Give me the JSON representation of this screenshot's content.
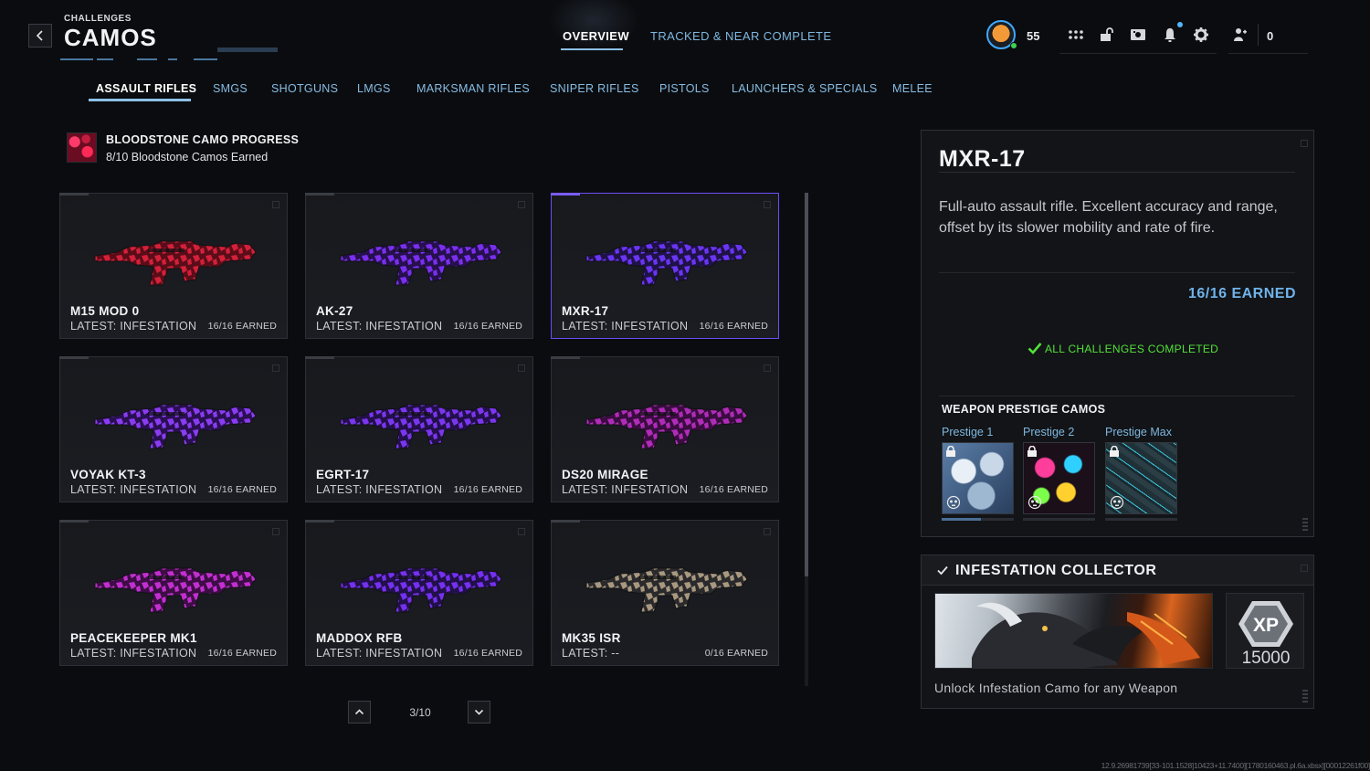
{
  "header": {
    "super_title": "CHALLENGES",
    "title": "CAMOS",
    "tabs": [
      {
        "label": "OVERVIEW",
        "active": true
      },
      {
        "label": "TRACKED & NEAR COMPLETE",
        "active": false
      }
    ],
    "level": "55",
    "currency": "0",
    "icons": [
      "grid-icon",
      "lock-icon",
      "store-icon",
      "bell-icon",
      "gear-icon",
      "party-icon"
    ]
  },
  "categories": [
    {
      "label": "ASSAULT RIFLES",
      "active": true
    },
    {
      "label": "SMGS"
    },
    {
      "label": "SHOTGUNS"
    },
    {
      "label": "LMGS"
    },
    {
      "label": "MARKSMAN RIFLES"
    },
    {
      "label": "SNIPER RIFLES"
    },
    {
      "label": "PISTOLS"
    },
    {
      "label": "LAUNCHERS & SPECIALS"
    },
    {
      "label": "MELEE"
    }
  ],
  "progress": {
    "title": "BLOODSTONE CAMO PROGRESS",
    "subtitle": "8/10 Bloodstone Camos Earned"
  },
  "weapons": [
    {
      "name": "M15 MOD 0",
      "latest": "LATEST: INFESTATION",
      "earned": "16/16 EARNED",
      "camo": "#d4203a",
      "accent": "#5a0d18"
    },
    {
      "name": "AK-27",
      "latest": "LATEST: INFESTATION",
      "earned": "16/16 EARNED",
      "camo": "#7a2ff0",
      "accent": "#26104d"
    },
    {
      "name": "MXR-17",
      "latest": "LATEST: INFESTATION",
      "earned": "16/16 EARNED",
      "camo": "#6a35f5",
      "accent": "#1f1247",
      "selected": true
    },
    {
      "name": "VOYAK KT-3",
      "latest": "LATEST: INFESTATION",
      "earned": "16/16 EARNED",
      "camo": "#8a3cf2",
      "accent": "#2a1052"
    },
    {
      "name": "EGRT-17",
      "latest": "LATEST: INFESTATION",
      "earned": "16/16 EARNED",
      "camo": "#7b36ef",
      "accent": "#23104a"
    },
    {
      "name": "DS20 MIRAGE",
      "latest": "LATEST: INFESTATION",
      "earned": "16/16 EARNED",
      "camo": "#b02cb8",
      "accent": "#3a0d40"
    },
    {
      "name": "PEACEKEEPER MK1",
      "latest": "LATEST: INFESTATION",
      "earned": "16/16 EARNED",
      "camo": "#c22fd0",
      "accent": "#3d0e45"
    },
    {
      "name": "MADDOX RFB",
      "latest": "LATEST: INFESTATION",
      "earned": "16/16 EARNED",
      "camo": "#7530f0",
      "accent": "#22104a"
    },
    {
      "name": "MK35 ISR",
      "latest": "LATEST: --",
      "earned": "0/16 EARNED",
      "camo": "#a89880",
      "accent": "#2a2a2c"
    }
  ],
  "pager": {
    "label": "3/10"
  },
  "detail": {
    "name": "MXR-17",
    "description": "Full-auto assault rifle. Excellent accuracy and range, offset by its slower mobility and rate of fire.",
    "earned": "16/16 EARNED",
    "status": "ALL CHALLENGES COMPLETED",
    "prestige_title": "WEAPON PRESTIGE CAMOS",
    "prestige": [
      {
        "label": "Prestige 1",
        "progress": 0.55
      },
      {
        "label": "Prestige 2",
        "progress": 0
      },
      {
        "label": "Prestige Max",
        "progress": 0
      }
    ]
  },
  "collector": {
    "title": "INFESTATION COLLECTOR",
    "xp_label": "XP",
    "xp_value": "15000",
    "description": "Unlock Infestation Camo for any Weapon"
  },
  "build_id": "12.9.26981739[33-101.1528]10423+11.7400][1780160463.pl.6a.xbsx][00012261f00]",
  "colors": {
    "accent_blue": "#8ec1e8",
    "earned_blue": "#6fb3ec",
    "complete_green": "#53e03a",
    "selected_border": "#6c4df6"
  }
}
